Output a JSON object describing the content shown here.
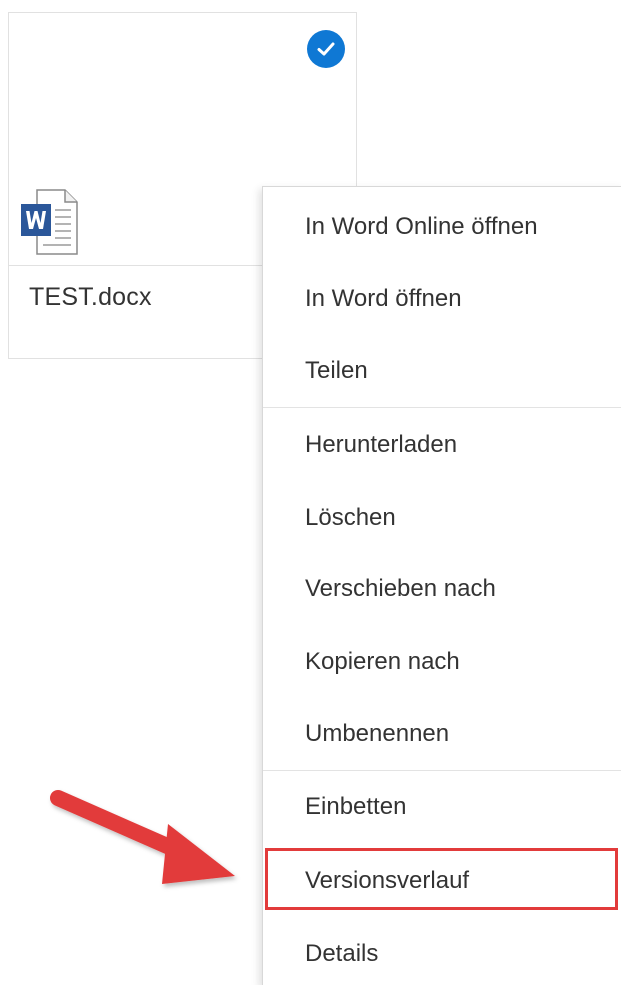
{
  "file": {
    "name": "TEST.docx",
    "icon": "word-doc-icon",
    "selected": true,
    "accent_color": "#0f78d4"
  },
  "menu": {
    "items": [
      {
        "label": "In Word Online öffnen"
      },
      {
        "label": "In Word öffnen"
      },
      {
        "label": "Teilen"
      },
      {
        "label": "Herunterladen"
      },
      {
        "label": "Löschen"
      },
      {
        "label": "Verschieben nach"
      },
      {
        "label": "Kopieren nach"
      },
      {
        "label": "Umbenennen"
      },
      {
        "label": "Einbetten"
      },
      {
        "label": "Versionsverlauf",
        "highlighted": true
      },
      {
        "label": "Details"
      }
    ]
  },
  "annotation": {
    "arrow_color": "#e23b3b",
    "highlight_color": "#e23b3b"
  }
}
